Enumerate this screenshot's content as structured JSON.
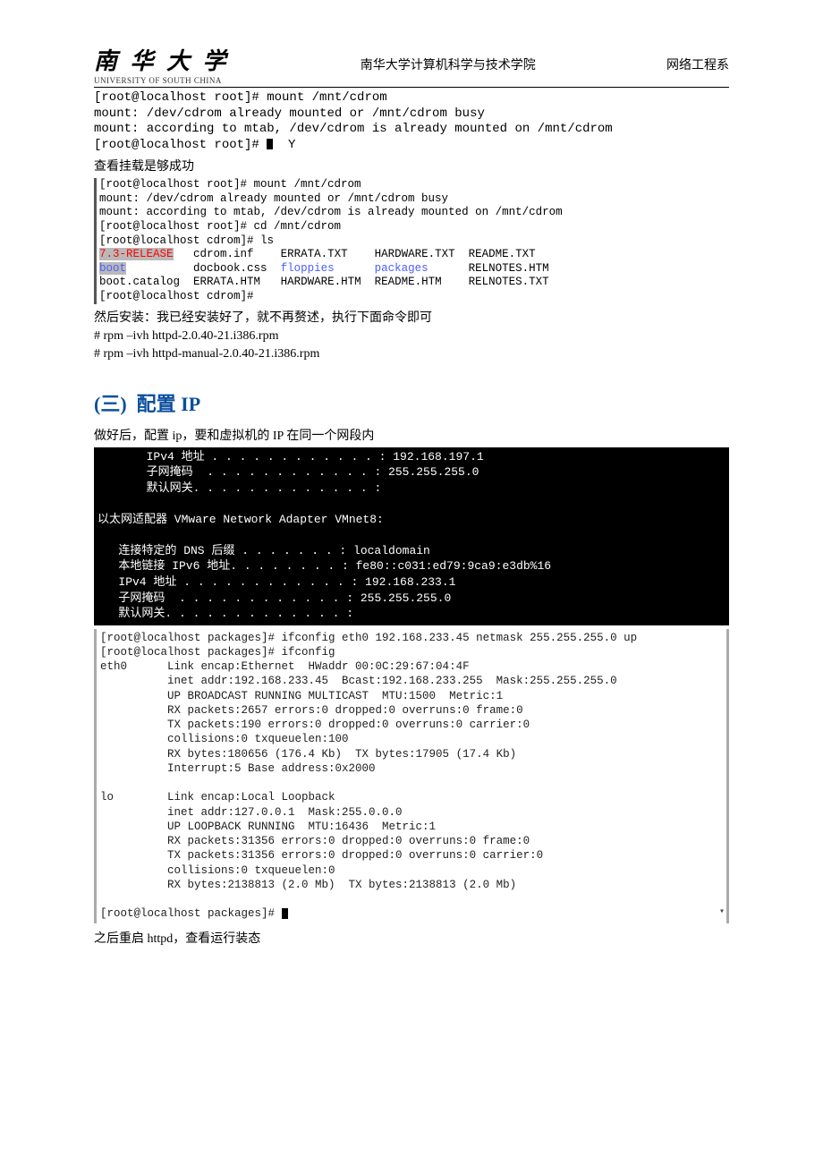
{
  "header": {
    "logo_cn": "南 华 大 学",
    "logo_en": "UNIVERSITY OF SOUTH CHINA",
    "center": "南华大学计算机科学与技术学院",
    "right": "网络工程系"
  },
  "term_block1": {
    "l1": "[root@localhost root]# mount /mnt/cdrom",
    "l2": "mount: /dev/cdrom already mounted or /mnt/cdrom busy",
    "l3": "mount: according to mtab, /dev/cdrom is already mounted on /mnt/cdrom",
    "l4": "[root@localhost root]# ",
    "l4b": "  Y"
  },
  "text1": "查看挂载是够成功",
  "term_block2": {
    "l1": "[root@localhost root]# mount /mnt/cdrom",
    "l2": "mount: /dev/cdrom already mounted or /mnt/cdrom busy",
    "l3": "mount: according to mtab, /dev/cdrom is already mounted on /mnt/cdrom",
    "l4": "[root@localhost root]# cd /mnt/cdrom",
    "l5a": "[root@localhost cdrom]# ls",
    "row1": {
      "c1": "7.3-RELEASE",
      "c2": "cdrom.inf",
      "c3": "ERRATA.TXT",
      "c4": "HARDWARE.TXT",
      "c5": "README.TXT"
    },
    "row2": {
      "c1": "boot",
      "c2": "docbook.css",
      "c3": "floppies",
      "c4": "packages",
      "c5": "RELNOTES.HTM"
    },
    "row3": {
      "c1": "boot.catalog",
      "c2": "ERRATA.HTM",
      "c3": "HARDWARE.HTM",
      "c4": "README.HTM",
      "c5": "RELNOTES.TXT"
    },
    "lend": "[root@localhost cdrom]#"
  },
  "text2": "然后安装：我已经安装好了，就不再赘述，执行下面命令即可",
  "cmd1": "#    rpm –ivh httpd-2.0.40-21.i386.rpm",
  "cmd2": "# rpm –ivh httpd-manual-2.0.40-21.i386.rpm",
  "heading3": {
    "num": "(三)",
    "cn": "配置",
    "lat": " IP"
  },
  "text3": "做好后，配置 ip，要和虚拟机的 IP 在同一个网段内",
  "dark": {
    "l0": "       IPv4 地址 . . . . . . . . . . . . : 192.168.197.1",
    "l1": "       子网掩码  . . . . . . . . . . . . : 255.255.255.0",
    "l2": "       默认网关. . . . . . . . . . . . . :",
    "l3": "",
    "l4": "以太网适配器 VMware Network Adapter VMnet8:",
    "l5": "",
    "l6": "   连接特定的 DNS 后缀 . . . . . . . : localdomain",
    "l7": "   本地链接 IPv6 地址. . . . . . . . : fe80::c031:ed79:9ca9:e3db%16",
    "l8": "   IPv4 地址 . . . . . . . . . . . . : 192.168.233.1",
    "l9": "   子网掩码  . . . . . . . . . . . . : 255.255.255.0",
    "l10": "   默认网关. . . . . . . . . . . . . :",
    "l11": ""
  },
  "light": {
    "l1": "[root@localhost packages]# ifconfig eth0 192.168.233.45 netmask 255.255.255.0 up",
    "l2": "[root@localhost packages]# ifconfig",
    "l3": "eth0      Link encap:Ethernet  HWaddr 00:0C:29:67:04:4F",
    "l4": "          inet addr:192.168.233.45  Bcast:192.168.233.255  Mask:255.255.255.0",
    "l5": "          UP BROADCAST RUNNING MULTICAST  MTU:1500  Metric:1",
    "l6": "          RX packets:2657 errors:0 dropped:0 overruns:0 frame:0",
    "l7": "          TX packets:190 errors:0 dropped:0 overruns:0 carrier:0",
    "l8": "          collisions:0 txqueuelen:100",
    "l9": "          RX bytes:180656 (176.4 Kb)  TX bytes:17905 (17.4 Kb)",
    "l10": "          Interrupt:5 Base address:0x2000",
    "l11": "",
    "l12": "lo        Link encap:Local Loopback",
    "l13": "          inet addr:127.0.0.1  Mask:255.0.0.0",
    "l14": "          UP LOOPBACK RUNNING  MTU:16436  Metric:1",
    "l15": "          RX packets:31356 errors:0 dropped:0 overruns:0 frame:0",
    "l16": "          TX packets:31356 errors:0 dropped:0 overruns:0 carrier:0",
    "l17": "          collisions:0 txqueuelen:0",
    "l18": "          RX bytes:2138813 (2.0 Mb)  TX bytes:2138813 (2.0 Mb)",
    "l19": "",
    "l20": "[root@localhost packages]# "
  },
  "text4": "之后重启 httpd，查看运行装态"
}
